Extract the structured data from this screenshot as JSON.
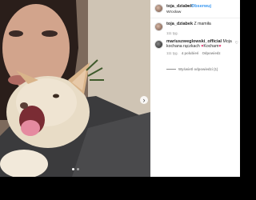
{
  "post": {
    "username": "toja_dziabek",
    "follow_label": "Obserwuj",
    "location": "Wrocław",
    "dot": "•",
    "next_icon": "chevron-right-icon"
  },
  "comments": [
    {
      "username": "toja_dziabek",
      "text": "Z mamiła",
      "meta": [
        "111 tyg."
      ]
    },
    {
      "username": "mariuszweglowski_official",
      "text": "Moja kochana rączkach",
      "heart_text": "Kocham",
      "meta": [
        "111 tyg.",
        "4 polubień",
        "Odpowiedz"
      ]
    }
  ],
  "replies_label": "Wyświetl odpowiedzi (1)",
  "carousel": {
    "count": 2,
    "active": 1
  }
}
